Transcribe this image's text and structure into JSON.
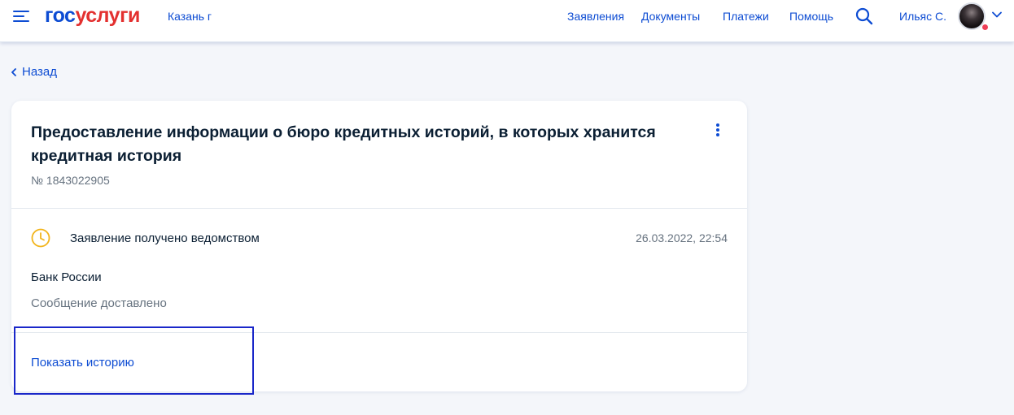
{
  "header": {
    "logo_part1": "гос",
    "logo_part2": "услуги",
    "city": "Казань г",
    "nav": [
      "Заявления",
      "Документы",
      "Платежи",
      "Помощь"
    ],
    "user_name": "Ильяс С."
  },
  "back_label": "Назад",
  "application": {
    "title": "Предоставление информации о бюро кредитных историй, в которых хранится кредитная история",
    "number": "№ 1843022905",
    "status": "Заявление получено ведомством",
    "status_date": "26.03.2022, 22:54",
    "organization": "Банк России",
    "message": "Сообщение доставлено",
    "show_history_label": "Показать историю"
  },
  "colors": {
    "brand_blue": "#0d4cd3",
    "brand_red": "#e3302f",
    "status_yellow": "#f2b51d",
    "notification_red": "#ee3f58",
    "highlight_border": "#1a27c9"
  },
  "icons": {
    "menu": "burger-menu-icon",
    "search": "search-icon",
    "back": "chevron-left-icon",
    "more": "more-vertical-icon",
    "status": "clock-icon",
    "dropdown": "chevron-down-icon"
  }
}
